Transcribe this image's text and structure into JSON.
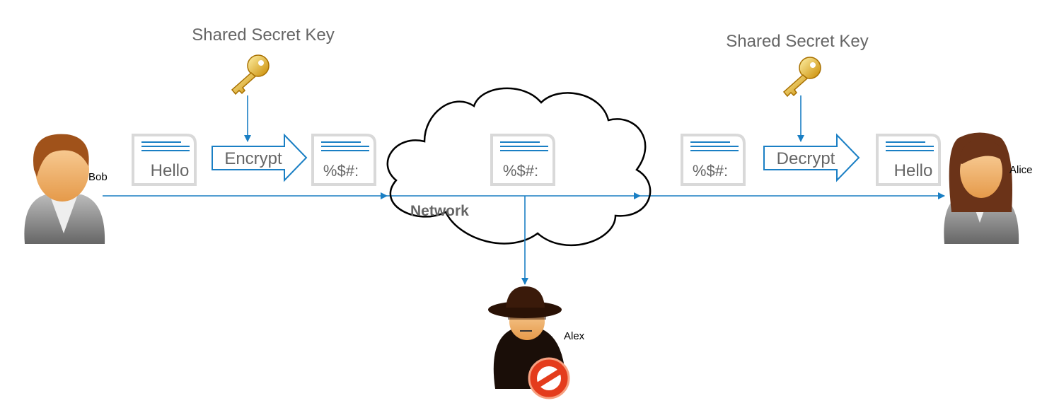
{
  "colors": {
    "accent": "#1a7fc4",
    "text": "#666666",
    "key": "#e8b923"
  },
  "left": {
    "key_label": "Shared Secret Key",
    "plaintext": "Hello",
    "action": "Encrypt",
    "ciphertext": "%$#:"
  },
  "network": {
    "label": "Network",
    "ciphertext": "%$#:"
  },
  "right": {
    "key_label": "Shared Secret Key",
    "ciphertext": "%$#:",
    "action": "Decrypt",
    "plaintext": "Hello"
  },
  "actors": {
    "sender": "Bob",
    "receiver": "Alice",
    "eavesdropper": "Alex"
  },
  "icons": [
    "user-male-icon",
    "user-female-icon",
    "spy-icon",
    "key-icon",
    "document-icon",
    "block-icon",
    "cloud-icon"
  ]
}
